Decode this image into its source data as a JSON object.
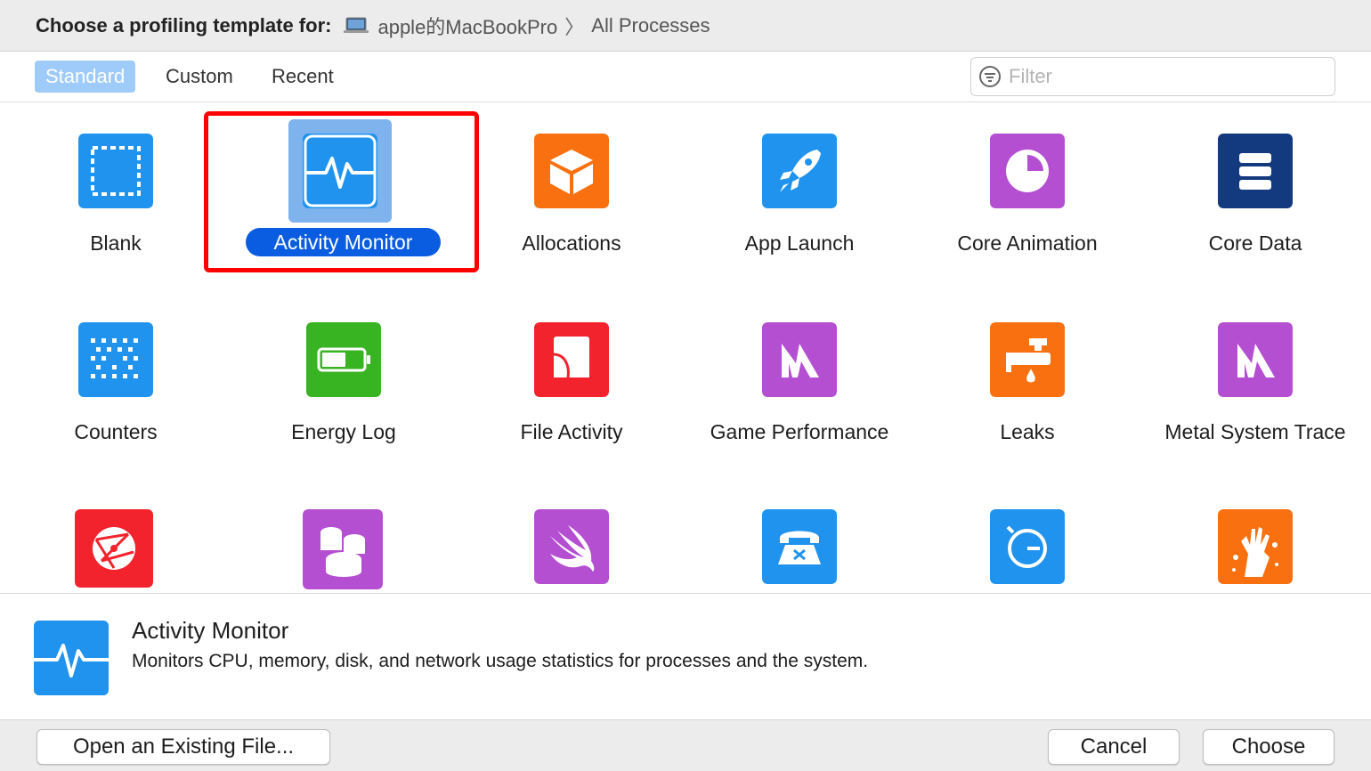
{
  "header": {
    "prompt": "Choose a profiling template for:",
    "device": "apple的MacBookPro",
    "target": "All Processes",
    "device_icon": "laptop-icon"
  },
  "tabs": [
    {
      "label": "Standard",
      "active": true
    },
    {
      "label": "Custom",
      "active": false
    },
    {
      "label": "Recent",
      "active": false
    }
  ],
  "filter": {
    "placeholder": "Filter",
    "value": ""
  },
  "templates": [
    {
      "label": "Blank",
      "icon": "blank-icon",
      "color": "#1f93ee"
    },
    {
      "label": "Activity Monitor",
      "icon": "activity-monitor-icon",
      "color": "#1f93ee",
      "selected": true
    },
    {
      "label": "Allocations",
      "icon": "allocations-icon",
      "color": "#f8700f"
    },
    {
      "label": "App Launch",
      "icon": "app-launch-icon",
      "color": "#1f93ee"
    },
    {
      "label": "Core Animation",
      "icon": "core-animation-icon",
      "color": "#b54fd2"
    },
    {
      "label": "Core Data",
      "icon": "core-data-icon",
      "color": "#13397f"
    },
    {
      "label": "Counters",
      "icon": "counters-icon",
      "color": "#1f93ee"
    },
    {
      "label": "Energy Log",
      "icon": "energy-log-icon",
      "color": "#38b321"
    },
    {
      "label": "File Activity",
      "icon": "file-activity-icon",
      "color": "#f2232d"
    },
    {
      "label": "Game Performance",
      "icon": "game-performance-icon",
      "color": "#b54fd2"
    },
    {
      "label": "Leaks",
      "icon": "leaks-icon",
      "color": "#f8700f"
    },
    {
      "label": "Metal System Trace",
      "icon": "metal-system-trace-icon",
      "color": "#b54fd2"
    },
    {
      "label": "",
      "icon": "network-icon",
      "color": "#f2232d"
    },
    {
      "label": "",
      "icon": "database-icon",
      "color": "#b54fd2"
    },
    {
      "label": "",
      "icon": "swift-icon",
      "color": "#b54fd2"
    },
    {
      "label": "",
      "icon": "telephone-icon",
      "color": "#1f93ee"
    },
    {
      "label": "",
      "icon": "timer-icon",
      "color": "#1f93ee"
    },
    {
      "label": "",
      "icon": "zombies-icon",
      "color": "#f8700f"
    }
  ],
  "description": {
    "title": "Activity Monitor",
    "text": "Monitors CPU, memory, disk, and network usage statistics for processes and the system.",
    "icon": "activity-monitor-icon"
  },
  "footer": {
    "open_label": "Open an Existing File...",
    "cancel_label": "Cancel",
    "choose_label": "Choose"
  },
  "colors": {
    "accent": "#0a5de0",
    "highlight": "#ff0000"
  }
}
